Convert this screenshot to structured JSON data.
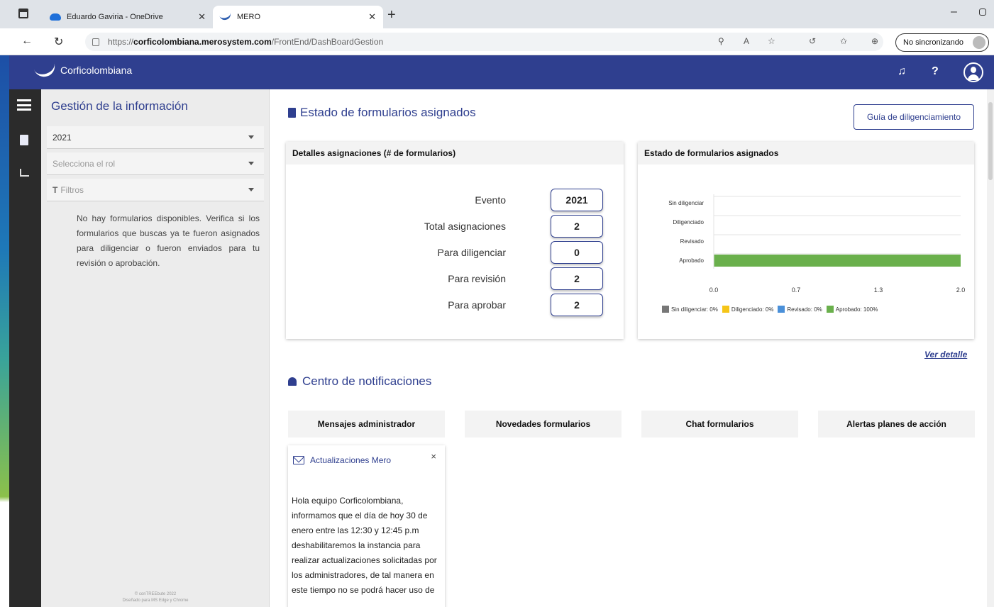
{
  "browser": {
    "tabs": [
      {
        "label": "Eduardo Gaviria - OneDrive",
        "favicon": "onedrive-cloud-icon"
      },
      {
        "label": "MERO",
        "favicon": "corficolombiana-logo-icon"
      }
    ],
    "url_prefix": "https://",
    "url_host": "corficolombiana.merosystem.com",
    "url_path": "/FrontEnd/DashBoardGestion",
    "sync_label": "No sincronizando"
  },
  "header": {
    "brand": "Corficolombiana",
    "help_label": "?",
    "colors": {
      "bar": "#2f3f8f",
      "accent": "#2f3f8f"
    }
  },
  "sidebar": {
    "title": "Gestión de la información",
    "year_select": "2021",
    "role_placeholder": "Selecciona el rol",
    "filters_label": "Filtros",
    "empty_message": "No hay formularios disponibles. Verifica si los formularios que buscas ya te fueron asignados para diligenciar o fueron enviados para tu revisión o aprobación.",
    "footer_line1": "© conTREEbute 2022",
    "footer_line2": "Diseñado para MS Edge y Chrome"
  },
  "main": {
    "title": "Estado de formularios asignados",
    "guide_button": "Guía de diligenciamiento",
    "details_card": {
      "title": "Detalles asignaciones (# de formularios)",
      "rows": [
        {
          "label": "Evento",
          "value": "2021"
        },
        {
          "label": "Total asignaciones",
          "value": "2"
        },
        {
          "label": "Para diligenciar",
          "value": "0"
        },
        {
          "label": "Para revisión",
          "value": "2"
        },
        {
          "label": "Para aprobar",
          "value": "2"
        }
      ]
    },
    "chart_card": {
      "title": "Estado de formularios asignados"
    },
    "ver_detalle": "Ver detalle",
    "notifications": {
      "title": "Centro de notificaciones",
      "tabs": [
        "Mensajes administrador",
        "Novedades formularios",
        "Chat formularios",
        "Alertas planes de acción"
      ],
      "message": {
        "title": "Actualizaciones Mero",
        "close": "×",
        "body": "Hola equipo Corficolombiana, informamos que el día de hoy 30 de enero entre las 12:30 y 12:45 p.m deshabilitaremos la instancia para realizar actualizaciones solicitadas por los administradores, de tal manera en este tiempo no se podrá hacer uso de"
      }
    }
  },
  "chart_data": {
    "type": "bar",
    "orientation": "horizontal",
    "categories": [
      "Sin diligenciar",
      "Diligenciado",
      "Revisado",
      "Aprobado"
    ],
    "values": [
      0,
      0,
      0,
      2
    ],
    "x_ticks": [
      "0.0",
      "0.7",
      "1.3",
      "2.0"
    ],
    "xlim": [
      0,
      2
    ],
    "bar_colors": [
      "#777777",
      "#f5c518",
      "#4a90d9",
      "#6ab04c"
    ],
    "legend": [
      {
        "label": "Sin diligenciar: 0%",
        "color": "#777777"
      },
      {
        "label": "Diligenciado: 0%",
        "color": "#f5c518"
      },
      {
        "label": "Revisado: 0%",
        "color": "#4a90d9"
      },
      {
        "label": "Aprobado: 100%",
        "color": "#6ab04c"
      }
    ],
    "legend_position": "bottom",
    "grid": true
  }
}
